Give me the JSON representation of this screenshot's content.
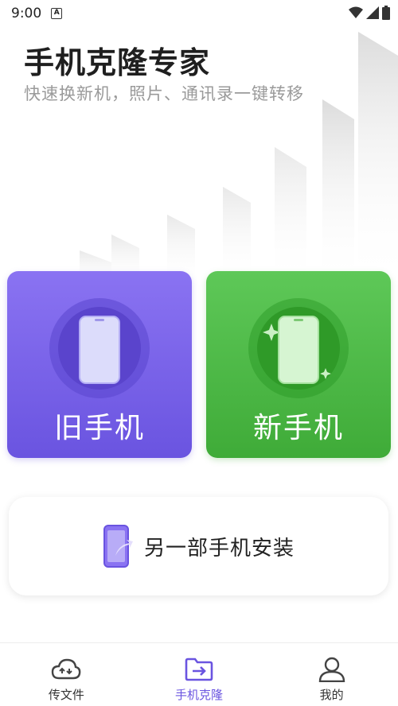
{
  "status_bar": {
    "time": "9:00",
    "notif_letter": "A"
  },
  "header": {
    "title": "手机克隆专家",
    "subtitle": "快速换新机，照片、通讯录一键转移"
  },
  "cards": {
    "old_phone": {
      "label": "旧手机",
      "color": "#7a63ea"
    },
    "new_phone": {
      "label": "新手机",
      "color": "#4cb845"
    }
  },
  "install_button": {
    "label": "另一部手机安装"
  },
  "bottom_nav": {
    "items": [
      {
        "label": "传文件",
        "icon": "cloud-transfer-icon",
        "active": false
      },
      {
        "label": "手机克隆",
        "icon": "folder-transfer-icon",
        "active": true
      },
      {
        "label": "我的",
        "icon": "user-icon",
        "active": false
      }
    ],
    "active_color": "#6a54e0"
  }
}
